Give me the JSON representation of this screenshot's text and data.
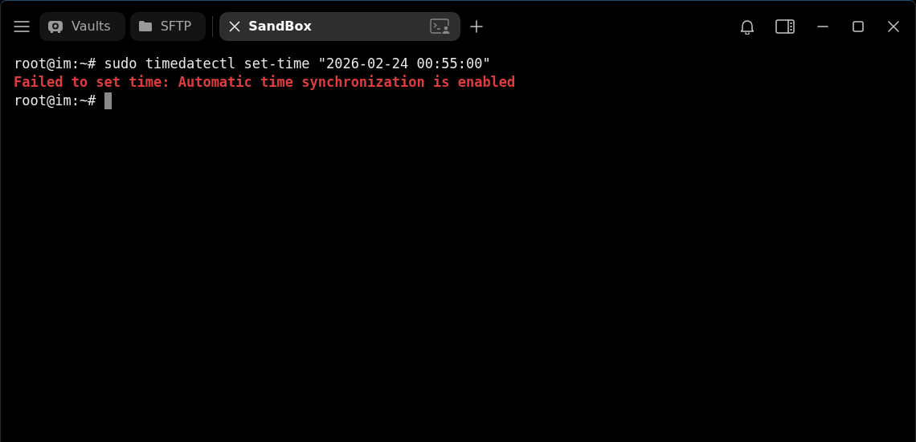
{
  "tabs": [
    {
      "label": "Vaults",
      "selected": false
    },
    {
      "label": "SFTP",
      "selected": false
    },
    {
      "label": "SandBox",
      "selected": true
    }
  ],
  "terminal": {
    "lines": [
      {
        "kind": "normal",
        "text": "root@im:~# sudo timedatectl set-time \"2026-02-24 00:55:00\"",
        "cursor": false
      },
      {
        "kind": "error",
        "text": "Failed to set time: Automatic time synchronization is enabled",
        "cursor": false
      },
      {
        "kind": "normal",
        "text": "root@im:~# ",
        "cursor": true
      }
    ]
  }
}
